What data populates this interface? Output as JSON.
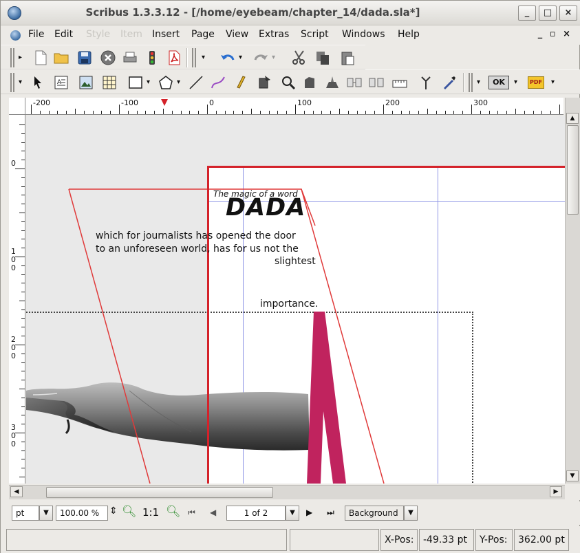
{
  "window": {
    "title": "Scribus 1.3.3.12 - [/home/eyebeam/chapter_14/dada.sla*]",
    "controls": {
      "minimize": "_",
      "maximize": "□",
      "close": "×"
    }
  },
  "menubar": {
    "items": [
      "File",
      "Edit",
      "Style",
      "Item",
      "Insert",
      "Page",
      "View",
      "Extras",
      "Script",
      "Windows",
      "Help"
    ],
    "disabled": [
      "Style",
      "Item"
    ],
    "mdi_controls": "_ ▫ ×"
  },
  "toolbar1": {
    "icons": [
      "new-document-icon",
      "open-folder-icon",
      "save-icon",
      "close-document-icon",
      "print-icon",
      "preflight-icon",
      "pdf-export-icon",
      "undo-icon",
      "redo-icon",
      "cut-icon",
      "copy-icon",
      "paste-icon"
    ]
  },
  "toolbar2": {
    "icons": [
      "select-arrow-icon",
      "text-frame-icon",
      "image-frame-icon",
      "table-icon",
      "rectangle-icon",
      "polygon-icon",
      "line-icon",
      "bezier-icon",
      "freehand-icon",
      "rotate-icon",
      "zoom-icon",
      "edit-contents-icon",
      "edit-text-icon",
      "link-frames-icon",
      "unlink-frames-icon",
      "measure-icon",
      "copy-properties-icon",
      "eyedropper-icon",
      "pdf-tools-icon",
      "pdf-fields-icon"
    ],
    "ok_label": "OK",
    "pdf_label": "PDF"
  },
  "rulers": {
    "horizontal_labels": [
      "-200",
      "-100",
      "0",
      "100",
      "200",
      "300"
    ],
    "vertical_labels": [
      "0",
      "100",
      "200",
      "300"
    ]
  },
  "canvas": {
    "heading_small": "The magic of a word",
    "heading_large": "DADA",
    "body_lines": [
      "which for journalists has opened the door",
      "to an unforeseen world, has for us not the",
      "slightest",
      "importance."
    ]
  },
  "bottombar": {
    "unit": "pt",
    "zoom": "100.00 %",
    "zoom_reset_label": "1:1",
    "page_indicator": "1 of 2",
    "layer": "Background"
  },
  "statusbar": {
    "message": "",
    "xpos_label": "X-Pos:",
    "xpos_value": "-49.33 pt",
    "ypos_label": "Y-Pos:",
    "ypos_value": "362.00 pt"
  },
  "colors": {
    "page_border": "#d4222a",
    "guides": "#8f95e6",
    "magenta_shape": "#c0235e",
    "text_frame_outline": "#e03a3a"
  }
}
